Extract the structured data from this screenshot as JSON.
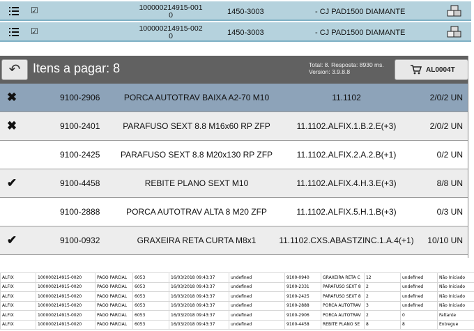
{
  "top_rows": [
    {
      "order": "100000214915-001",
      "order_suffix": "0",
      "code": "1450-3003",
      "desc": "- CJ PAD1500 DIAMANTE"
    },
    {
      "order": "100000214915-002",
      "order_suffix": "0",
      "code": "1450-3003",
      "desc": "- CJ PAD1500 DIAMANTE"
    }
  ],
  "header": {
    "back_icon": "↶",
    "title": "Itens a pagar: 8",
    "stats_line1": "Total: 8. Resposta: 8930 ms.",
    "stats_line2": "Version: 3.9.8.8",
    "cart_button": "AL0004T"
  },
  "items": [
    {
      "status": "✖",
      "code": "9100-2906",
      "desc": "PORCA AUTOTRAV BAIXA A2-70 M10",
      "loc": "11.1102",
      "qty": "2/0/2 UN"
    },
    {
      "status": "✖",
      "code": "9100-2401",
      "desc": "PARAFUSO SEXT 8.8 M16x60 RP ZFP",
      "loc": "11.1102.ALFIX.1.B.2.E(+3)",
      "qty": "2/0/2 UN"
    },
    {
      "status": "",
      "code": "9100-2425",
      "desc": "PARAFUSO SEXT 8.8 M20x130 RP ZFP",
      "loc": "11.1102.ALFIX.2.A.2.B(+1)",
      "qty": "0/2 UN"
    },
    {
      "status": "✔",
      "code": "9100-4458",
      "desc": "REBITE PLANO SEXT M10",
      "loc": "11.1102.ALFIX.4.H.3.E(+3)",
      "qty": "8/8 UN"
    },
    {
      "status": "",
      "code": "9100-2888",
      "desc": "PORCA AUTOTRAV ALTA 8 M20 ZFP",
      "loc": "11.1102.ALFIX.5.H.1.B(+3)",
      "qty": "0/3 UN"
    },
    {
      "status": "✔",
      "code": "9100-0932",
      "desc": "GRAXEIRA RETA CURTA  M8x1",
      "loc": "11.1102.CXS.ABASTZINC.1.A.4(+1)",
      "qty": "10/10 UN"
    }
  ],
  "sheet": [
    [
      "ALFIX",
      "100000214915-0020",
      "PAGO PARCIAL",
      "6053",
      "16/03/2018 09:43:37",
      "undefined",
      "9100-0940",
      "GRAXEIRA RETA C",
      "12",
      "undefined",
      "Não Iniciado"
    ],
    [
      "ALFIX",
      "100000214915-0020",
      "PAGO PARCIAL",
      "6053",
      "16/03/2018 09:43:37",
      "undefined",
      "9100-2331",
      "PARAFUSO SEXT 8",
      "2",
      "undefined",
      "Não Iniciado"
    ],
    [
      "ALFIX",
      "100000214915-0020",
      "PAGO PARCIAL",
      "6053",
      "16/03/2018 09:43:37",
      "undefined",
      "9100-2425",
      "PARAFUSO SEXT 8",
      "2",
      "undefined",
      "Não Iniciado"
    ],
    [
      "ALFIX",
      "100000214915-0020",
      "PAGO PARCIAL",
      "6053",
      "16/03/2018 09:43:37",
      "undefined",
      "9100-2888",
      "PORCA AUTOTRAV",
      "3",
      "undefined",
      "Não Iniciado"
    ],
    [
      "ALFIX",
      "100000214915-0020",
      "PAGO PARCIAL",
      "6053",
      "16/03/2018 09:43:37",
      "undefined",
      "9100-2906",
      "PORCA AUTOTRAV",
      "2",
      "0",
      "Faltante"
    ],
    [
      "ALFIX",
      "100000214915-0020",
      "PAGO PARCIAL",
      "6053",
      "16/03/2018 09:43:37",
      "undefined",
      "9100-4458",
      "REBITE PLANO SE",
      "8",
      "8",
      "Entregue"
    ]
  ]
}
